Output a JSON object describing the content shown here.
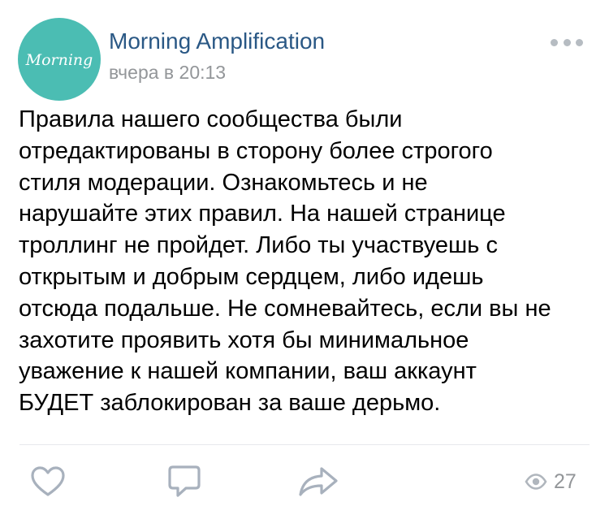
{
  "post": {
    "author": "Morning Amplification",
    "timestamp": "вчера в 20:13",
    "avatar_text": "Morning",
    "text_lines": [
      "Правила нашего сообщества были",
      "отредактированы в сторону более строгого",
      "стиля модерации. Ознакомьтесь и не",
      "нарушайте этих правил. На нашей странице",
      "троллинг не пройдет. Либо ты участвуешь с",
      "открытым и добрым сердцем, либо идешь",
      "отсюда подальше. Не сомневайтесь, если вы не",
      "захотите проявить хотя бы минимальное",
      "уважение к нашей компании, ваш аккаунт",
      "БУДЕТ заблокирован за ваше дерьмо."
    ]
  },
  "actions": {
    "like_icon": "heart-icon",
    "comment_icon": "comment-icon",
    "share_icon": "share-icon",
    "views_icon": "eye-icon",
    "views_count": "27"
  },
  "colors": {
    "author": "#2a5885",
    "meta": "#939699",
    "icon": "#a8b1bd",
    "avatar_bg": "#4bbdb3",
    "text": "#000000"
  }
}
